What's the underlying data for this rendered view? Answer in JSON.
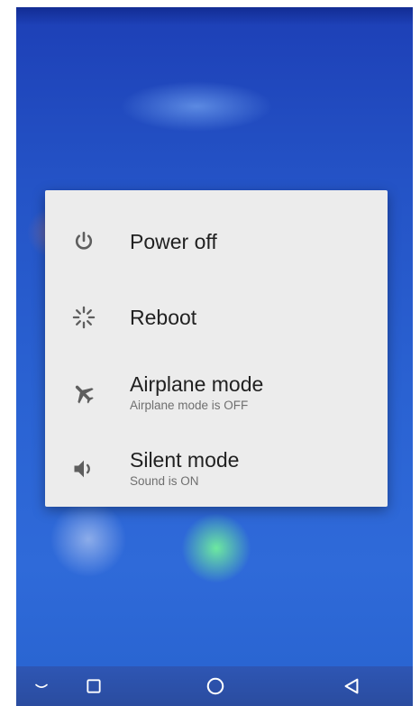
{
  "power_menu": {
    "items": [
      {
        "id": "power-off",
        "icon": "power-icon",
        "title": "Power off",
        "subtitle": ""
      },
      {
        "id": "reboot",
        "icon": "reboot-spinner-icon",
        "title": "Reboot",
        "subtitle": ""
      },
      {
        "id": "airplane-mode",
        "icon": "airplane-icon",
        "title": "Airplane mode",
        "subtitle": "Airplane mode is OFF"
      },
      {
        "id": "silent-mode",
        "icon": "speaker-icon",
        "title": "Silent mode",
        "subtitle": "Sound is ON"
      }
    ]
  },
  "navbar": {
    "buttons": [
      {
        "id": "hide-keyboard",
        "icon": "chevron-down-icon"
      },
      {
        "id": "recents",
        "icon": "square-recents-icon"
      },
      {
        "id": "home",
        "icon": "circle-home-icon"
      },
      {
        "id": "back",
        "icon": "triangle-back-icon"
      }
    ]
  },
  "colors": {
    "dialog_background": "#ececec",
    "primary_text": "#212121",
    "secondary_text": "#6f6f6f",
    "icon": "#5e5e5e",
    "navbar": "#2b4fa8"
  }
}
